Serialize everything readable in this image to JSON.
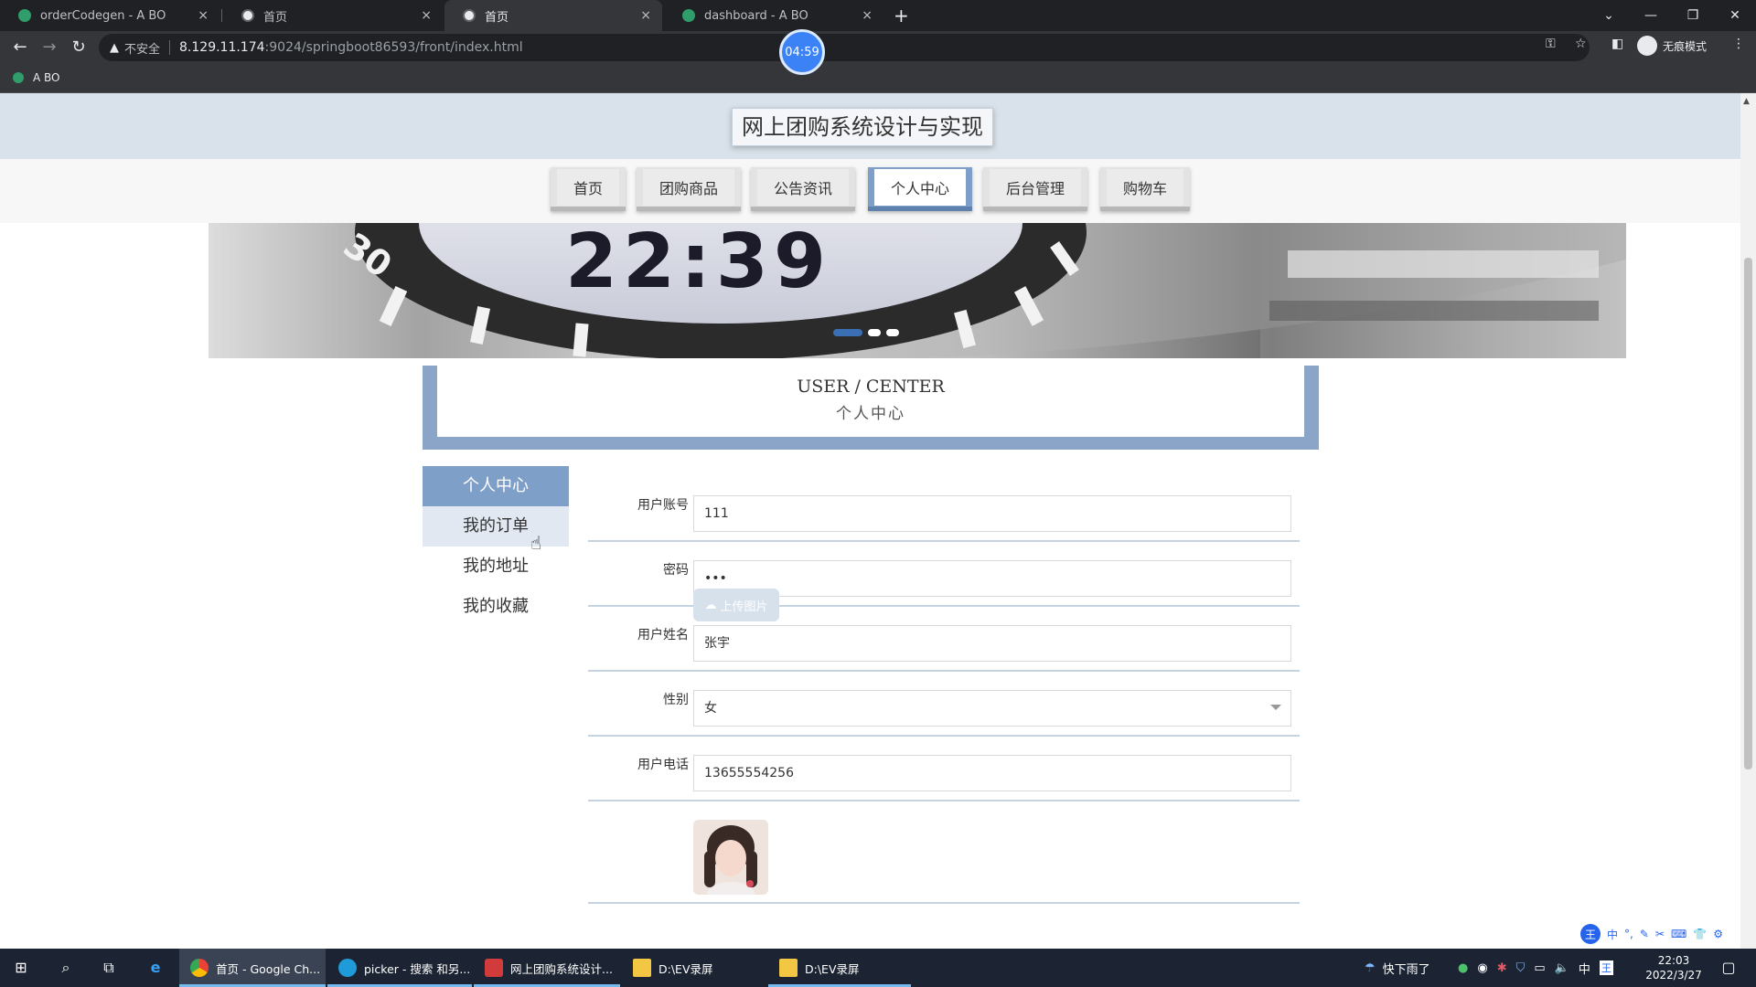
{
  "browser": {
    "tabs": [
      {
        "label": "orderCodegen - A BO",
        "icon": "green-leaf-icon"
      },
      {
        "label": "首页",
        "icon": "globe-icon"
      },
      {
        "label": "首页",
        "icon": "globe-icon"
      },
      {
        "label": "dashboard - A BO",
        "icon": "green-leaf-icon"
      }
    ],
    "close_glyph": "×",
    "new_tab_glyph": "+",
    "security_text": "不安全",
    "url_host": "8.129.11.174",
    "url_path": ":9024/springboot86593/front/index.html",
    "profile_label": "无痕模式",
    "timer": "04:59",
    "bookmark": "A BO"
  },
  "site": {
    "title": "网上团购系统设计与实现",
    "nav": [
      "首页",
      "团购商品",
      "公告资讯",
      "个人中心",
      "后台管理",
      "购物车"
    ],
    "active_nav": "个人中心",
    "banner_slides": 3,
    "banner_active_slide": 1,
    "section_en": "USER / CENTER",
    "section_cn": "个人中心"
  },
  "sidebar": {
    "items": [
      "个人中心",
      "我的订单",
      "我的地址",
      "我的收藏"
    ],
    "active": "个人中心",
    "hovered": "我的订单"
  },
  "form": {
    "username_label": "用户账号",
    "username_value": "111",
    "password_label": "密码",
    "password_value": "•••",
    "name_label": "用户姓名",
    "name_value": "张宇",
    "gender_label": "性别",
    "gender_value": "女",
    "phone_label": "用户电话",
    "phone_value": "13655554256",
    "upload_label": "上传图片"
  },
  "taskbar": {
    "apps": [
      {
        "label": "首页 - Google Ch...",
        "icon": "chrome-icon"
      },
      {
        "label": "picker - 搜索 和另...",
        "icon": "edge-icon"
      },
      {
        "label": "网上团购系统设计...",
        "icon": "wps-icon"
      },
      {
        "label": "D:\\EV录屏",
        "icon": "folder-icon"
      },
      {
        "label": "D:\\EV录屏",
        "icon": "folder-icon"
      }
    ],
    "weather": "快下雨了",
    "ime_lang": "中",
    "time": "22:03",
    "date": "2022/3/27"
  },
  "colors": {
    "accent": "#7e9fc8",
    "header_bg": "#d9e1ea",
    "chrome_dark": "#202124",
    "taskbar": "#1c2433"
  }
}
